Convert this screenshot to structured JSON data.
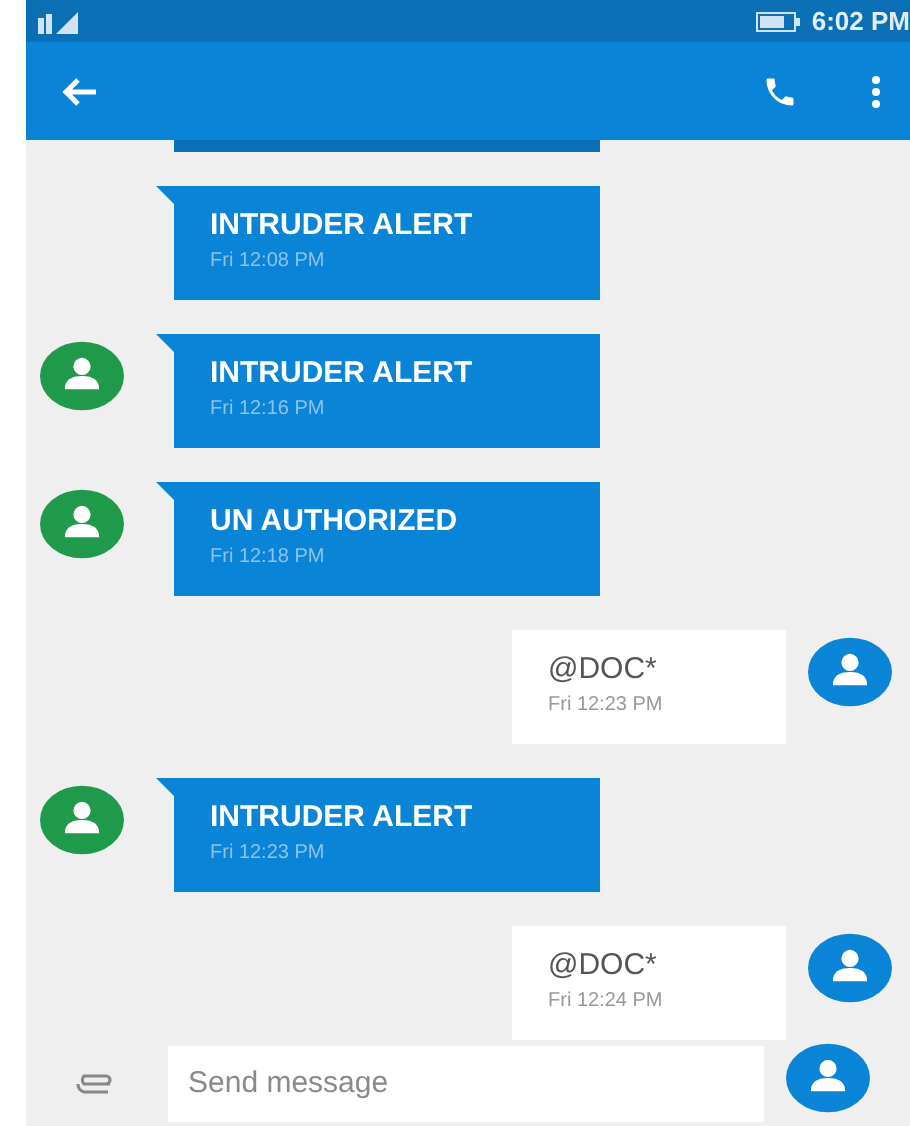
{
  "status_bar": {
    "time": "6:02 PM"
  },
  "messages": [
    {
      "kind": "incoming",
      "cut_off": true
    },
    {
      "kind": "incoming",
      "text": "INTRUDER ALERT",
      "time": "Fri 12:08 PM",
      "avatar": false
    },
    {
      "kind": "incoming",
      "text": "INTRUDER ALERT",
      "time": "Fri 12:16 PM",
      "avatar": true
    },
    {
      "kind": "incoming",
      "text": "UN AUTHORIZED",
      "time": "Fri 12:18 PM",
      "avatar": true
    },
    {
      "kind": "outgoing",
      "text": "@DOC*",
      "time": "Fri 12:23 PM",
      "avatar": true
    },
    {
      "kind": "incoming",
      "text": "INTRUDER ALERT",
      "time": "Fri 12:23 PM",
      "avatar": true
    },
    {
      "kind": "outgoing",
      "text": "@DOC*",
      "time": "Fri 12:24 PM",
      "avatar": true
    }
  ],
  "composer": {
    "placeholder": "Send message"
  }
}
